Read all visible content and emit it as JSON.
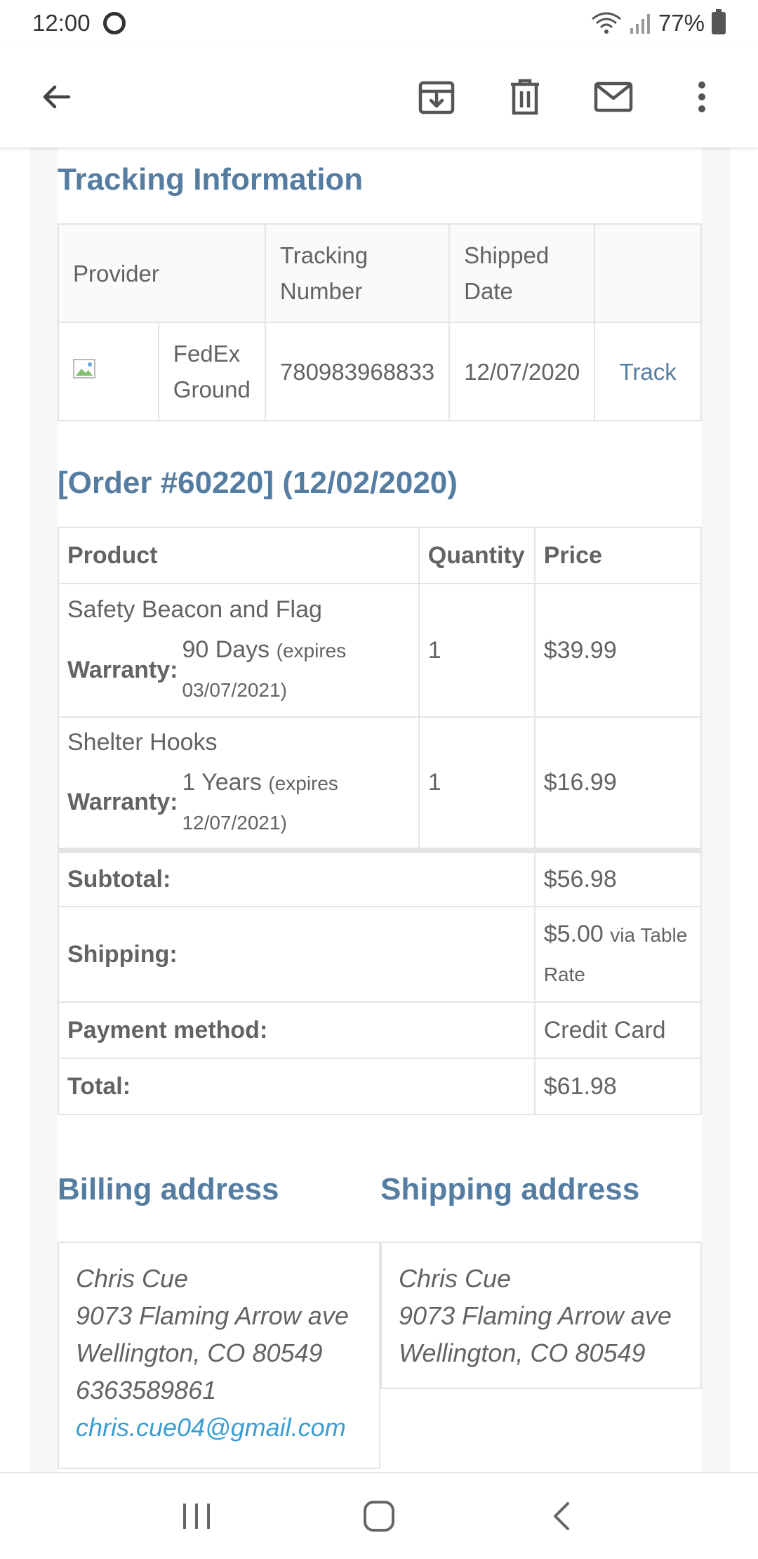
{
  "status_bar": {
    "time": "12:00",
    "battery": "77%",
    "icons": [
      "wifi-icon",
      "signal-icon",
      "battery-icon"
    ]
  },
  "app_bar": {
    "icons": [
      "back-arrow-icon",
      "archive-icon",
      "delete-icon",
      "mail-icon",
      "more-vert-icon"
    ]
  },
  "tracking": {
    "title": "Tracking Information",
    "headers": {
      "provider": "Provider",
      "tracking_number": "Tracking Number",
      "shipped_date": "Shipped Date",
      "action": ""
    },
    "row": {
      "provider_name": "FedEx Ground",
      "tracking_number": "780983968833",
      "shipped_date": "12/07/2020",
      "track_link": "Track"
    }
  },
  "order": {
    "title": "[Order #60220] (12/02/2020)",
    "headers": {
      "product": "Product",
      "quantity": "Quantity",
      "price": "Price"
    },
    "items": [
      {
        "name": "Safety Beacon and Flag",
        "warranty_label": "Warranty:",
        "warranty_value": "90 Days",
        "warranty_expires": "(expires 03/07/2021)",
        "quantity": "1",
        "price": "$39.99"
      },
      {
        "name": "Shelter Hooks",
        "warranty_label": "Warranty:",
        "warranty_value": "1 Years",
        "warranty_expires": "(expires 12/07/2021)",
        "quantity": "1",
        "price": "$16.99"
      }
    ],
    "totals": {
      "subtotal_label": "Subtotal:",
      "subtotal": "$56.98",
      "shipping_label": "Shipping:",
      "shipping_amount": "$5.00",
      "shipping_method": "via Table Rate",
      "payment_label": "Payment method:",
      "payment": "Credit Card",
      "total_label": "Total:",
      "total": "$61.98"
    }
  },
  "billing": {
    "title": "Billing address",
    "name": "Chris Cue",
    "street": "9073 Flaming Arrow ave",
    "city": "Wellington, CO 80549",
    "phone": "6363589861",
    "email": "chris.cue04@gmail.com"
  },
  "shipping": {
    "title": "Shipping address",
    "name": "Chris Cue",
    "street": "9073 Flaming Arrow ave",
    "city": "Wellington, CO 80549"
  },
  "nav_bar": {
    "icons": [
      "recent-apps-icon",
      "home-icon",
      "nav-back-icon"
    ]
  },
  "colors": {
    "heading": "#557da1",
    "text": "#636363",
    "link": "#3c9dd0",
    "border": "#e4e4e4"
  }
}
